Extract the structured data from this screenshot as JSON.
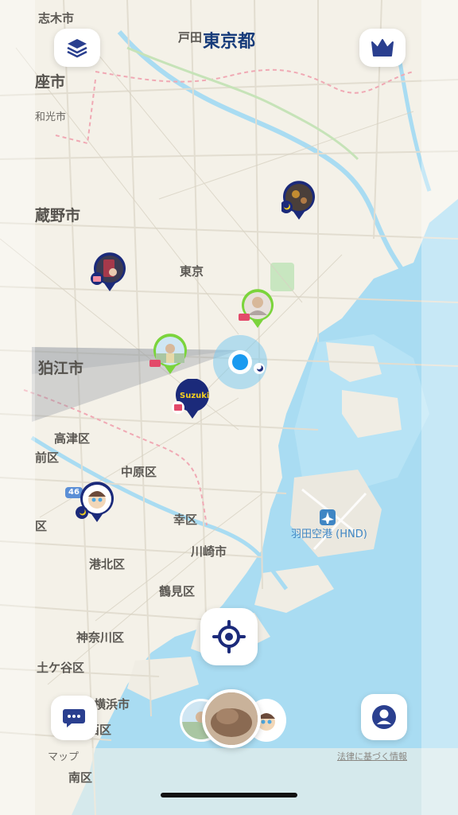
{
  "header": {
    "title": "東京都"
  },
  "map_labels": {
    "shiki": "志木市",
    "toda": "戸田",
    "zama": "座市",
    "wako": "和光市",
    "musashino": "蔵野市",
    "tokyo": "東京",
    "komae": "狛江市",
    "takatsu": "高津区",
    "miyamae": "前区",
    "nakahara": "中原区",
    "tama": "区",
    "saiwai": "幸区",
    "kawasaki": "川崎市",
    "kohoku": "港北区",
    "tsurumi": "鶴見区",
    "kanagawa": "神奈川区",
    "hodogaya": "土ケ谷区",
    "yokohama": "横浜市",
    "nishi": "西区",
    "minami": "南区",
    "route": "46",
    "airport": "羽田空港 (HND)",
    "apple_maps": "マップ",
    "legal": "法律に基づく情報"
  },
  "pins": {
    "suzuki_label": "Suzuki"
  },
  "icons": {
    "layers": "layers-icon",
    "crown": "crown-icon",
    "locate": "locate-icon",
    "chat": "chat-icon",
    "profile": "profile-icon"
  },
  "colors": {
    "title": "#163b7a",
    "water": "#a9dcf2",
    "land": "#f4f1e8",
    "pin_navy": "#1b2a7a",
    "pin_green": "#7bd43c",
    "user_dot": "#1a9af0",
    "button_icon": "#2a3f8f"
  }
}
